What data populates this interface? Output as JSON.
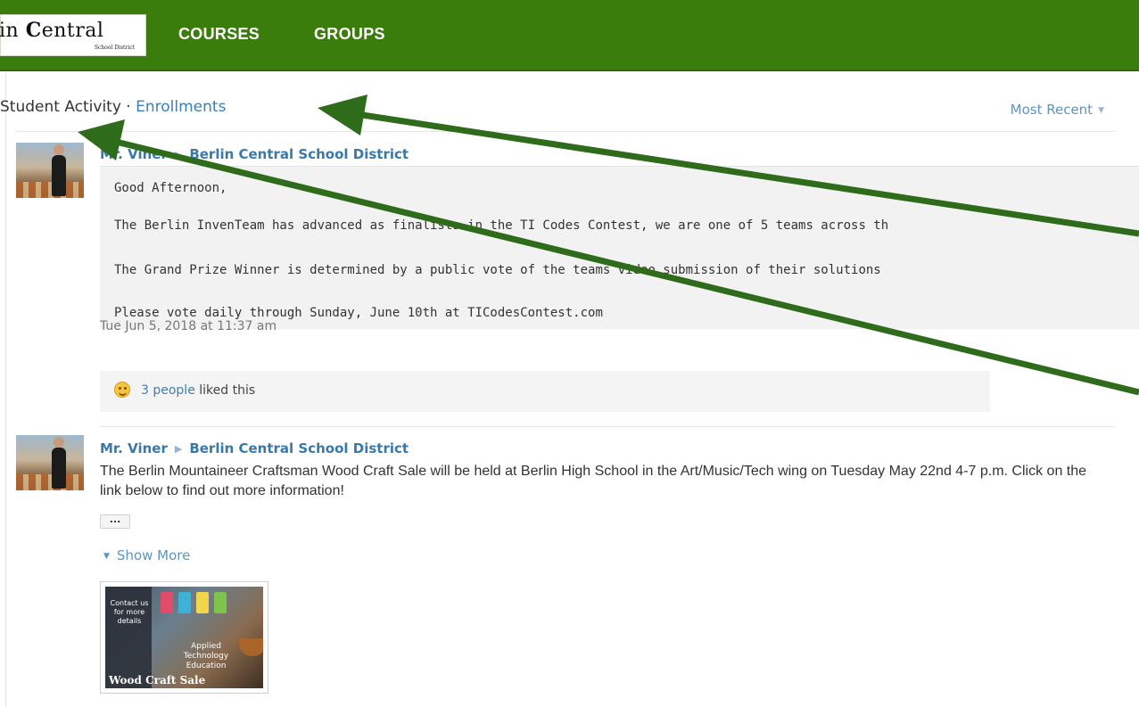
{
  "header": {
    "logo_text_prefix": "in ",
    "logo_text_c": "C",
    "logo_text_rest": "entral",
    "logo_subtext": "School District",
    "nav": [
      {
        "label": "COURSES"
      },
      {
        "label": "GROUPS"
      }
    ],
    "brand_color": "#3b7d0c"
  },
  "feed": {
    "heading_prefix": "Student Activity · ",
    "heading_link": "Enrollments",
    "sort_label": "Most Recent",
    "posts": [
      {
        "author": "Mr. Viner",
        "group": "Berlin Central School District",
        "lines": [
          "Good Afternoon,",
          "The Berlin InvenTeam has advanced as finalists in the TI Codes Contest, we are one of 5 teams across th",
          "The Grand Prize Winner is determined by a public vote of the teams video submission of their solutions",
          "Please vote daily through Sunday, June 10th at TICodesContest.com"
        ],
        "timestamp": "Tue Jun 5, 2018 at 11:37 am",
        "likes_link": "3 people",
        "likes_suffix": " liked this"
      },
      {
        "author": "Mr. Viner",
        "group": "Berlin Central School District",
        "body": "The Berlin Mountaineer Craftsman Wood Craft Sale will be held at Berlin High School in the Art/Music/Tech wing on Tuesday May 22nd 4-7 p.m. Click on the link below to find out more information!",
        "ellipsis": "...",
        "show_more": "Show More",
        "thumb_text_1": "Contact us for more details",
        "thumb_text_2": "Applied Technology Education",
        "thumb_text_3": "Wood Craft Sale"
      }
    ]
  },
  "icons": {
    "arrow_separator": "triangle-right-icon",
    "sort_caret": "caret-down-icon",
    "like": "smiley-icon",
    "show_more": "caret-down-icon"
  },
  "annotation_color": "#2e6b1a"
}
